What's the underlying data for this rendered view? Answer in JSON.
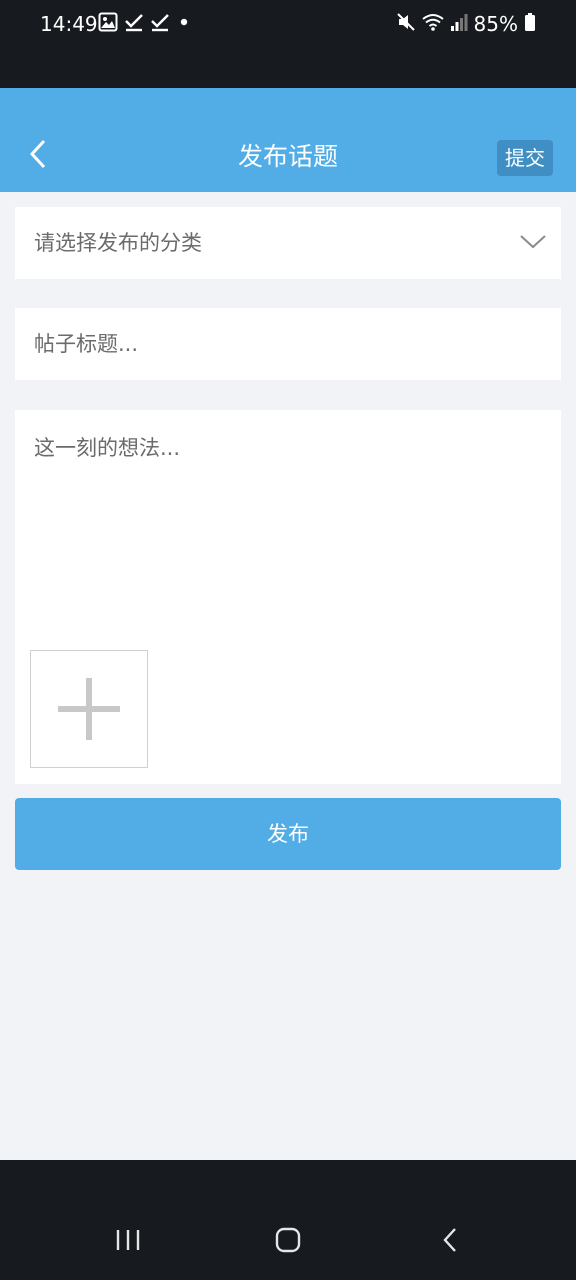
{
  "status_bar": {
    "time": "14:49",
    "battery": "85%",
    "left_icons": [
      "image-icon",
      "check-icon",
      "check-icon",
      "dot-icon"
    ],
    "right_icons": [
      "mute-icon",
      "wifi-icon",
      "signal-icon",
      "battery-icon"
    ]
  },
  "header": {
    "title": "发布话题",
    "submit_label": "提交",
    "back_icon": "chevron-left-icon",
    "background": "#52ace5"
  },
  "form": {
    "category_placeholder": "请选择发布的分类",
    "title_placeholder": "帖子标题...",
    "content_placeholder": "这一刻的想法...",
    "add_image_icon": "plus-icon"
  },
  "publish_button": {
    "label": "发布"
  },
  "nav_bar": {
    "buttons": [
      "recent-apps-icon",
      "home-icon",
      "back-icon"
    ]
  }
}
